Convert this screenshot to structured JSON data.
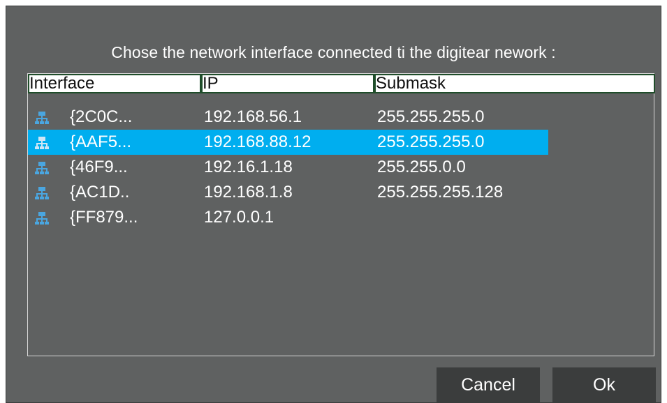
{
  "dialog": {
    "prompt": "Chose the network interface connected ti the digitear nework :"
  },
  "table": {
    "columns": [
      "Interface",
      "IP",
      "Submask"
    ],
    "rows": [
      {
        "interface": "{2C0C...",
        "ip": "192.168.56.1",
        "submask": "255.255.255.0",
        "selected": false
      },
      {
        "interface": "{AAF5...",
        "ip": "192.168.88.12",
        "submask": "255.255.255.0",
        "selected": true
      },
      {
        "interface": "{46F9...",
        "ip": "192.16.1.18",
        "submask": "255.255.0.0",
        "selected": false
      },
      {
        "interface": "{AC1D..",
        "ip": "192.168.1.8",
        "submask": "255.255.255.128",
        "selected": false
      },
      {
        "interface": "{FF879...",
        "ip": "127.0.0.1",
        "submask": "",
        "selected": false
      }
    ],
    "row_icon": "network-icon"
  },
  "buttons": {
    "cancel": "Cancel",
    "ok": "Ok"
  },
  "colors": {
    "background": "#5f6161",
    "selection": "#00aeef",
    "header_border": "#1f4d2a",
    "button": "#3b3d3d",
    "icon": "#4aa6e0"
  }
}
